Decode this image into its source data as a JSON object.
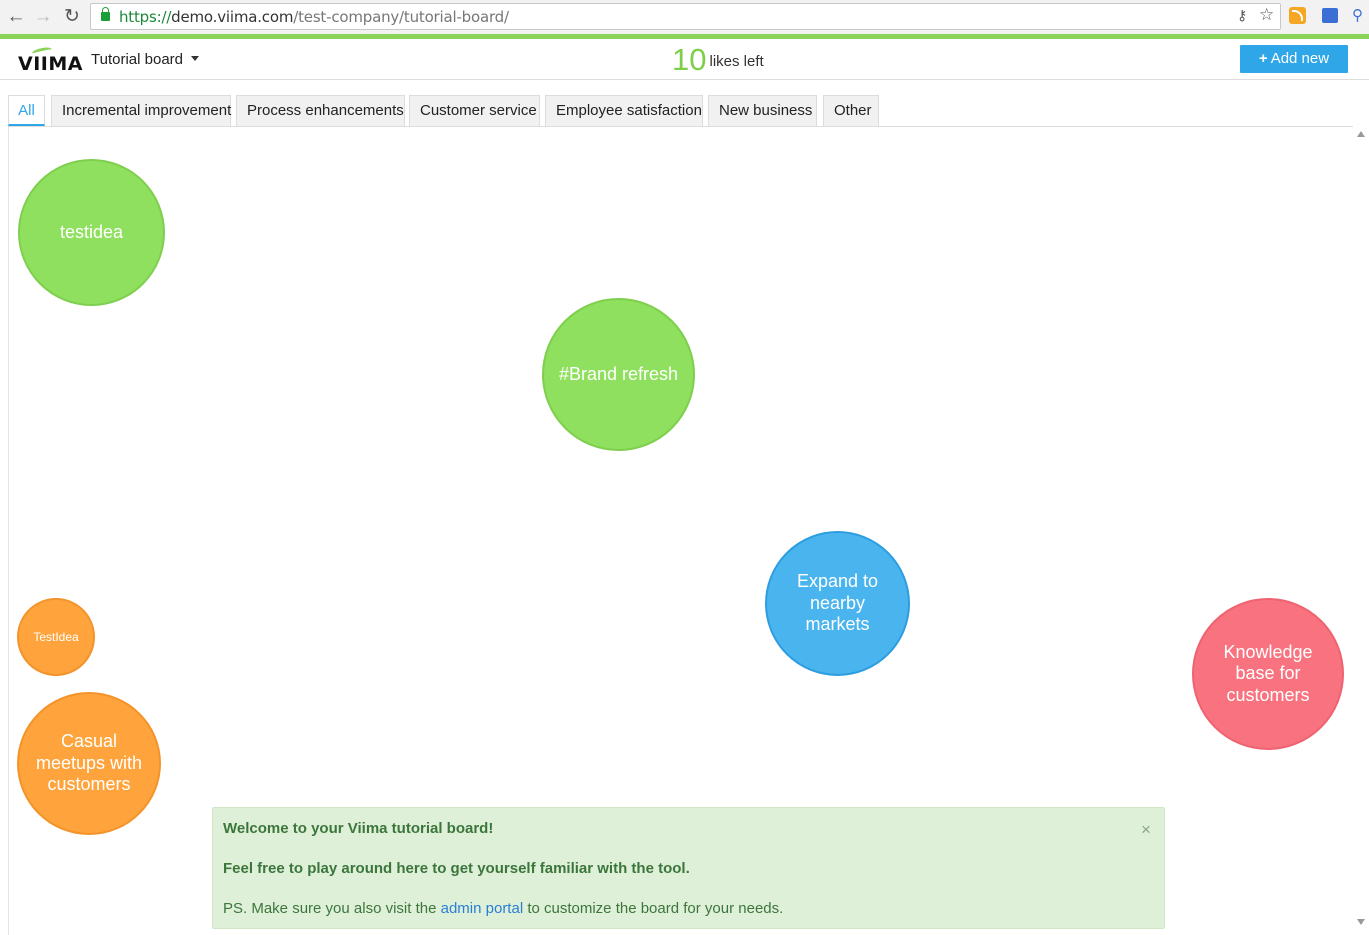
{
  "browser": {
    "url_scheme": "https://",
    "url_host": "demo.viima.com",
    "url_path": "/test-company/tutorial-board/"
  },
  "header": {
    "logo": "VIIMA",
    "board_name": "Tutorial board",
    "likes_count": "10",
    "likes_label": "likes left",
    "add_button": "Add new",
    "accent_color": "#8cd35a",
    "button_color": "#2ea6e8"
  },
  "tabs": [
    {
      "label": "All",
      "active": true
    },
    {
      "label": "Incremental improvement"
    },
    {
      "label": "Process enhancements"
    },
    {
      "label": "Customer service"
    },
    {
      "label": "Employee satisfaction"
    },
    {
      "label": "New business"
    },
    {
      "label": "Other"
    }
  ],
  "ideas": [
    {
      "title": "testidea",
      "color": "green"
    },
    {
      "title": "#Brand refresh",
      "color": "green"
    },
    {
      "title": "Expand to nearby markets",
      "color": "blue"
    },
    {
      "title": "TestIdea",
      "color": "orange"
    },
    {
      "title": "Casual meetups with customers",
      "color": "orange"
    },
    {
      "title": "Knowledge base for customers",
      "color": "red"
    }
  ],
  "welcome": {
    "title": "Welcome to your Viima tutorial board!",
    "line2": "Feel free to play around here to get yourself familiar with the tool.",
    "line3_prefix": "PS. Make sure you also visit the",
    "link": "admin portal",
    "line3_suffix": "to customize the board for your needs.",
    "close": "×"
  }
}
